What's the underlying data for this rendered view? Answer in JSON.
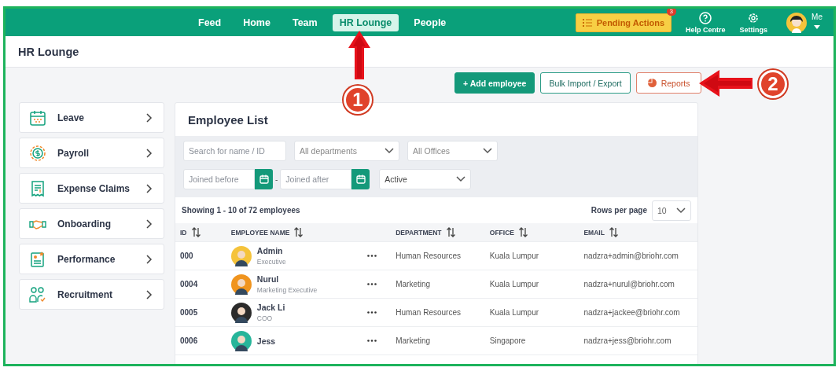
{
  "nav": {
    "tabs": [
      {
        "label": "Feed",
        "selected": false
      },
      {
        "label": "Home",
        "selected": false
      },
      {
        "label": "Team",
        "selected": false
      },
      {
        "label": "HR Lounge",
        "selected": true
      },
      {
        "label": "People",
        "selected": false
      }
    ],
    "pending_actions": {
      "label": "Pending Actions",
      "badge": "3"
    },
    "help": "Help Centre",
    "settings": "Settings",
    "profile": "Me"
  },
  "page_title": "HR Lounge",
  "actions": [
    "+ Add employee",
    "Bulk Import / Export",
    "Reports"
  ],
  "sidebar": {
    "items": [
      {
        "label": "Leave"
      },
      {
        "label": "Payroll"
      },
      {
        "label": "Expense Claims"
      },
      {
        "label": "Onboarding"
      },
      {
        "label": "Performance"
      },
      {
        "label": "Recruitment"
      }
    ]
  },
  "employee_list": {
    "title": "Employee List",
    "filters": {
      "search": {
        "placeholder": "Search for name / ID"
      },
      "department": "All departments",
      "office": "All Offices",
      "joined_before": {
        "placeholder": "Joined before"
      },
      "separator": "-",
      "joined_after": {
        "placeholder": "Joined after"
      },
      "status": "Active"
    },
    "summary": "Showing 1 - 10 of 72 employees",
    "rows_per_page": {
      "label": "Rows per page",
      "value": "10"
    },
    "columns": [
      "ID",
      "EMPLOYEE NAME",
      "DEPARTMENT",
      "OFFICE",
      "EMAIL"
    ],
    "rows": [
      {
        "id": "000",
        "name": "Admin",
        "title": "Executive",
        "color": "#f5c33b",
        "department": "Human Resources",
        "office": "Kuala Lumpur",
        "email": "nadzra+admin@briohr.com"
      },
      {
        "id": "0004",
        "name": "Nurul",
        "title": "Marketing Executive",
        "color": "#f0941e",
        "department": "Marketing",
        "office": "Kuala Lumpur",
        "email": "nadzra+nurul@briohr.com"
      },
      {
        "id": "0005",
        "name": "Jack Li",
        "title": "COO",
        "color": "#2b2b2b",
        "department": "Human Resources",
        "office": "Kuala Lumpur",
        "email": "nadzra+jackee@briohr.com"
      },
      {
        "id": "0006",
        "name": "Jess",
        "title": "",
        "color": "#27b59a",
        "department": "Marketing",
        "office": "Singapore",
        "email": "nadzra+jess@briohr.com"
      }
    ]
  },
  "annotations": [
    "1",
    "2"
  ]
}
